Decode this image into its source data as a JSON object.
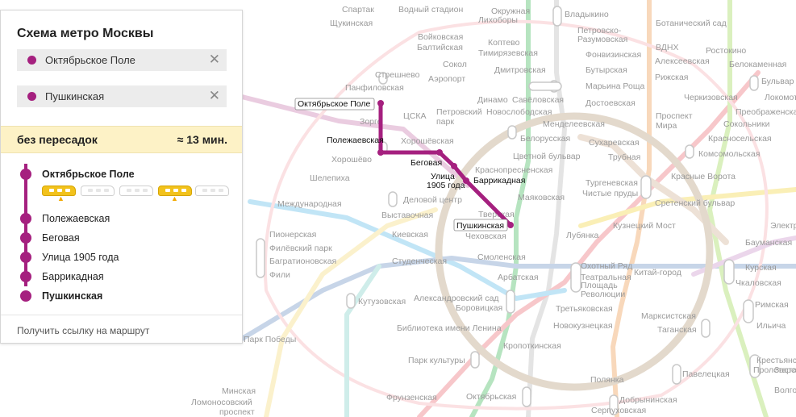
{
  "panel": {
    "title": "Схема метро Москвы",
    "from_station": "Октябрьское Поле",
    "to_station": "Пушкинская",
    "clear_symbol": "✕",
    "summary_left": "без пересадок",
    "summary_right": "≈ 13 мин.",
    "stops": [
      {
        "name": "Октябрьское Поле"
      },
      {
        "name": "Полежаевская"
      },
      {
        "name": "Беговая"
      },
      {
        "name": "Улица 1905 года"
      },
      {
        "name": "Баррикадная"
      },
      {
        "name": "Пушкинская"
      }
    ],
    "route_link": "Получить ссылку на маршрут"
  },
  "colors": {
    "route": "#a5207f",
    "summary_bg": "#fdf2c6",
    "train_highlight": "#f2c21c"
  },
  "icons": [
    "close-icon",
    "train-car-icon",
    "up-arrow-icon",
    "station-dot-icon"
  ],
  "map": {
    "callouts": {
      "oktyabrskoe": "Октябрьское Поле",
      "polezhaevskaya": "Полежаевская",
      "begovaya": "Беговая",
      "ulitsa1": "Улица",
      "ulitsa2": "1905 года",
      "barrikadnaya": "Баррикадная",
      "pushkinskaya": "Пушкинская"
    },
    "labels": [
      "Спартак",
      "Щукинская",
      "Водный стадион",
      "Войковская",
      "Балтийская",
      "Окружная",
      "Лихоборы",
      "Владыкино",
      "Петровско-",
      "Разумовская",
      "Ботанический сад",
      "ВДНХ",
      "Ростокино",
      "Алексеевская",
      "Белокаменная",
      "Рижская",
      "Коптево",
      "Тимирязевская",
      "Фонвизинская",
      "Бутырская",
      "Марьина Роща",
      "Достоевская",
      "Сокол",
      "Аэропорт",
      "Дмитровская",
      "Савёловская",
      "Динамо",
      "Новослободская",
      "Петровский",
      "парк",
      "Менделеевская",
      "Стрешнево",
      "Панфиловская",
      "Зорге",
      "ЦСКА",
      "Хорошёвская",
      "Хорошёво",
      "Шелепиха",
      "Деловой центр",
      "Выставочная",
      "Международная",
      "Белорусская",
      "Цветной бульвар",
      "Трубная",
      "Сухаревская",
      "Проспект",
      "Мира",
      "Бульвар",
      "Локомотив",
      "Черкизовская",
      "Преображенская",
      "Сокольники",
      "Красносельская",
      "Комсомольская",
      "Красные Ворота",
      "Тургеневская",
      "Чистые пруды",
      "Сретенский бульвар",
      "Краснопресненская",
      "Маяковская",
      "Тверская",
      "Чеховская",
      "Пионерская",
      "Филёвский парк",
      "Багратионовская",
      "Фили",
      "Кутузовская",
      "Киевская",
      "Студенческая",
      "Смоленская",
      "Арбатская",
      "Александровский сад",
      "Боровицкая",
      "Библиотека имени Ленина",
      "Кузнецкий Мост",
      "Лубянка",
      "Охотный Ряд",
      "Театральная",
      "Площадь",
      "Революции",
      "Китай-город",
      "Курская",
      "Чкаловская",
      "Бауманская",
      "Электрозаводская",
      "Третьяковская",
      "Новокузнецкая",
      "Марксистская",
      "Таганская",
      "Римская",
      "Ильича",
      "Крестьянская",
      "Застава",
      "Пролетарская",
      "Кропоткинская",
      "Парк культуры",
      "Фрунзенская",
      "Октябрьская",
      "Добрынинская",
      "Серпуховская",
      "Полянка",
      "Павелецкая",
      "Минская",
      "Ломоносовский",
      "проспект",
      "Парк Победы",
      "Волгоградский"
    ]
  }
}
